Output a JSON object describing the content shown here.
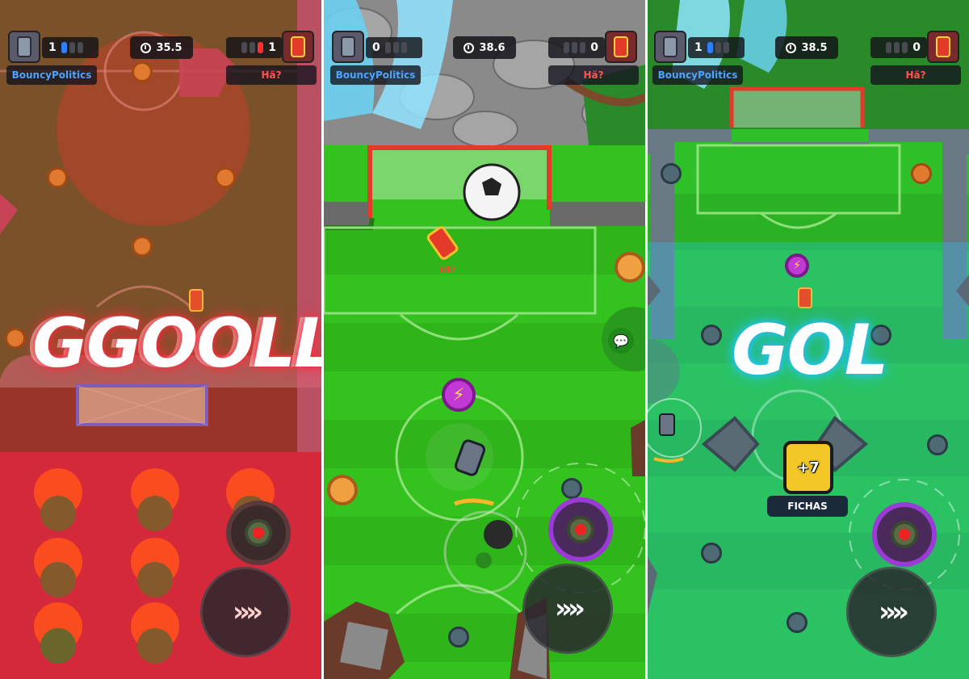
{
  "panels": [
    {
      "player_name": "BouncyPolitics",
      "player_score": "1",
      "opponent_score": "1",
      "opponent_name": "Hä?",
      "timer": "35.5",
      "banner": "GGOOLL",
      "boost_glyph": "»»"
    },
    {
      "player_name": "BouncyPolitics",
      "player_score": "0",
      "opponent_score": "0",
      "opponent_name": "Hä?",
      "timer": "38.6",
      "car_label": "Hä?",
      "boost_glyph": "»»"
    },
    {
      "player_name": "BouncyPolitics",
      "player_score": "1",
      "opponent_score": "0",
      "opponent_name": "Hä?",
      "timer": "38.5",
      "banner": "GOL",
      "reward_amount": "+7",
      "reward_label": "FICHAS",
      "boost_glyph": "»»"
    }
  ],
  "icons": {
    "timer": "stopwatch-icon",
    "boost": "triple-chevron-icon",
    "fire": "fire-button-icon",
    "power": "lightning-bolt-icon",
    "chat": "chat-bubble-icon"
  },
  "colors": {
    "player_blue": "#2f7fff",
    "opponent_red": "#ff3030",
    "field_green": "#33c21e",
    "goal_red": "#e0302a",
    "goal_glow_blue": "#23c8ff",
    "fire_ring": "#9b3bd6"
  }
}
